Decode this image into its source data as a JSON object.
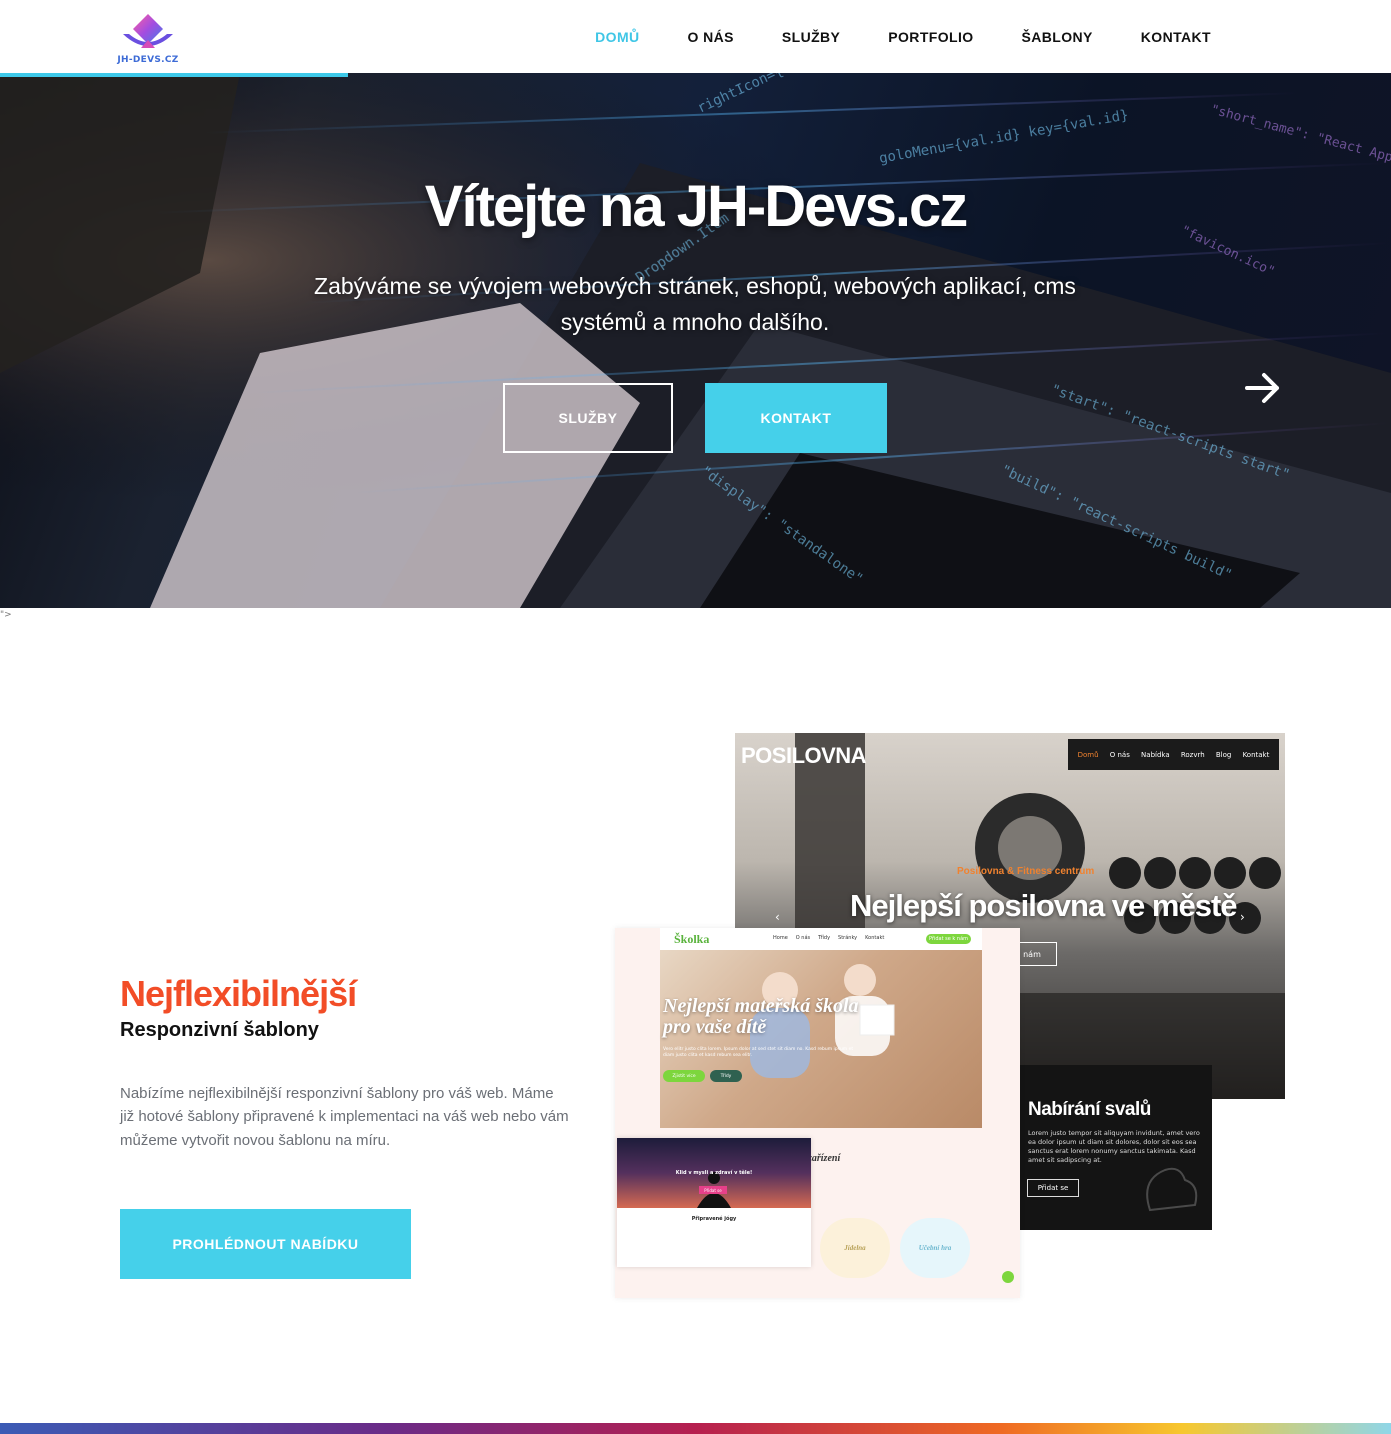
{
  "header": {
    "logo_text": "JH-DEVS.CZ",
    "nav": [
      {
        "label": "DOMŮ",
        "active": true
      },
      {
        "label": "O NÁS",
        "active": false
      },
      {
        "label": "SLUŽBY",
        "active": false
      },
      {
        "label": "PORTFOLIO",
        "active": false
      },
      {
        "label": "ŠABLONY",
        "active": false
      },
      {
        "label": "KONTAKT",
        "active": false
      }
    ],
    "progress_fraction": 0.25
  },
  "hero": {
    "title": "Vítejte na JH-Devs.cz",
    "subtitle": "Zabýváme se vývojem webových stránek, eshopů, webových aplikací, cms systémů a mnoho dalšího.",
    "btn_services": "SLUŽBY",
    "btn_contact": "KONTAKT",
    "next_icon": "arrow-right-icon"
  },
  "stray_text": "\">",
  "feature": {
    "title": "Nejflexibilnější",
    "subtitle": "Responzivní šablony",
    "text": "Nabízíme nejflexibilnější responzivní šablony pro váš web. Máme již hotové šablony připravené k implementaci na váš web nebo vám můžeme vytvořit novou šablonu na míru.",
    "button": "PROHLÉDNOUT NABÍDKU"
  },
  "mockups": {
    "gym": {
      "brand": "POSILOVNA",
      "nav": [
        "Domů",
        "O nás",
        "Nabídka",
        "Rozvrh",
        "Blog",
        "Kontakt"
      ],
      "kicker": "Posilovna & Fitness centrum",
      "headline": "Nejlepší posilovna ve městě",
      "button": "nám",
      "card_title": "Nabírání svalů",
      "card_text": "Lorem justo tempor sit aliquyam invidunt, amet vero ea dolor ipsum ut diam sit dolores, dolor sit eos sea sanctus erat lorem nonumy sanctus takimata. Kasd amet sit sadipscing at.",
      "card_button": "Přidat se"
    },
    "kindergarten": {
      "logo": "Školka",
      "nav": [
        "Home",
        "O nás",
        "Třídy",
        "Stránky",
        "Kontakt"
      ],
      "pill": "Přidat se k nám",
      "headline": "Nejlepší mateřská škola pro vaše dítě",
      "paragraph": "Vero elitr justo clita lorem. Ipsum dolor at sed stet sit diam no. Kasd rebum ipsum et diam justo clita et kasd rebum sea elitr.",
      "btn_primary": "Zjistit více",
      "btn_secondary": "Třídy",
      "section_title": "zařízení",
      "features": [
        "Jídelna",
        "Učební hra"
      ]
    },
    "yoga": {
      "title": "Klid v mysli a zdraví v těle!",
      "button": "Přidat se",
      "section": "Připravené jógy"
    }
  },
  "colors": {
    "accent": "#45d0ea",
    "nav_active": "#3fc6e6",
    "feature_title": "#f24d27"
  }
}
